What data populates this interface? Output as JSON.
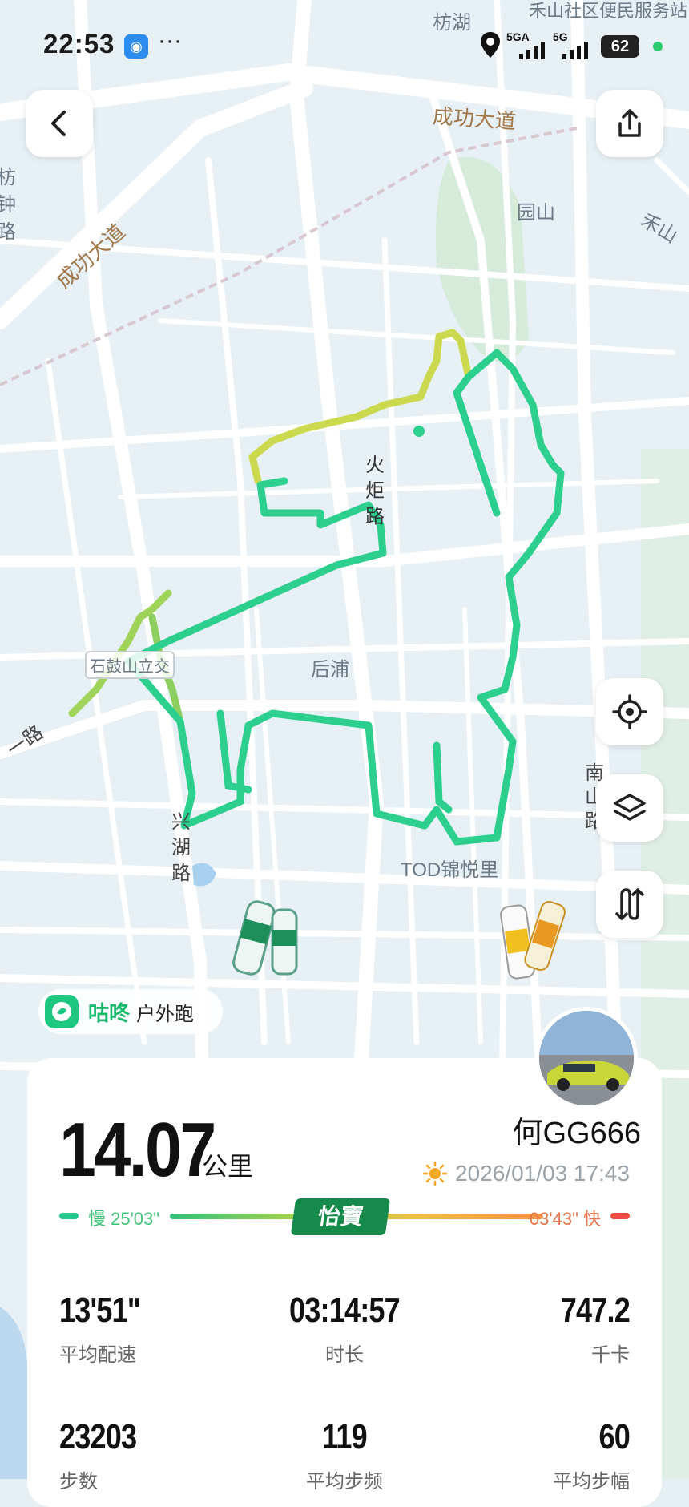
{
  "status_bar": {
    "time": "22:53",
    "more": "···",
    "sig1": "5GA",
    "sig2": "5G",
    "battery": "62"
  },
  "map": {
    "labels": {
      "fanghu": "枋湖",
      "heshan_service": "禾山社区便民服务站",
      "chenggong1": "成功大道",
      "chenggong2": "成功大道",
      "yuanshan": "园山",
      "heshan": "禾山",
      "fangzhong": "枋钟路",
      "huoju": "火炬路",
      "houpu": "后浦",
      "shijiao": "石鼓山立交",
      "xinghu": "兴湖路",
      "tod": "TOD锦悦里",
      "nan": "南山路",
      "yi_road": "一路"
    }
  },
  "brand": {
    "name": "咕咚",
    "activity": "户外跑"
  },
  "user": {
    "name": "何GG666"
  },
  "summary": {
    "distance": "14.07",
    "unit": "公里",
    "datetime": "2026/01/03 17:43"
  },
  "pace_bar": {
    "slow": "慢 25'03\"",
    "fast": "03'43\" 快",
    "sponsor": "怡寶"
  },
  "stats": [
    {
      "value": "13'51\"",
      "label": "平均配速"
    },
    {
      "value": "03:14:57",
      "label": "时长"
    },
    {
      "value": "747.2",
      "label": "千卡"
    },
    {
      "value": "23203",
      "label": "步数"
    },
    {
      "value": "119",
      "label": "平均步频"
    },
    {
      "value": "60",
      "label": "平均步幅"
    }
  ],
  "colors": {
    "route_start": "#d4dd4a",
    "route_main": "#2ccf8e",
    "accent": "#1fc880"
  }
}
